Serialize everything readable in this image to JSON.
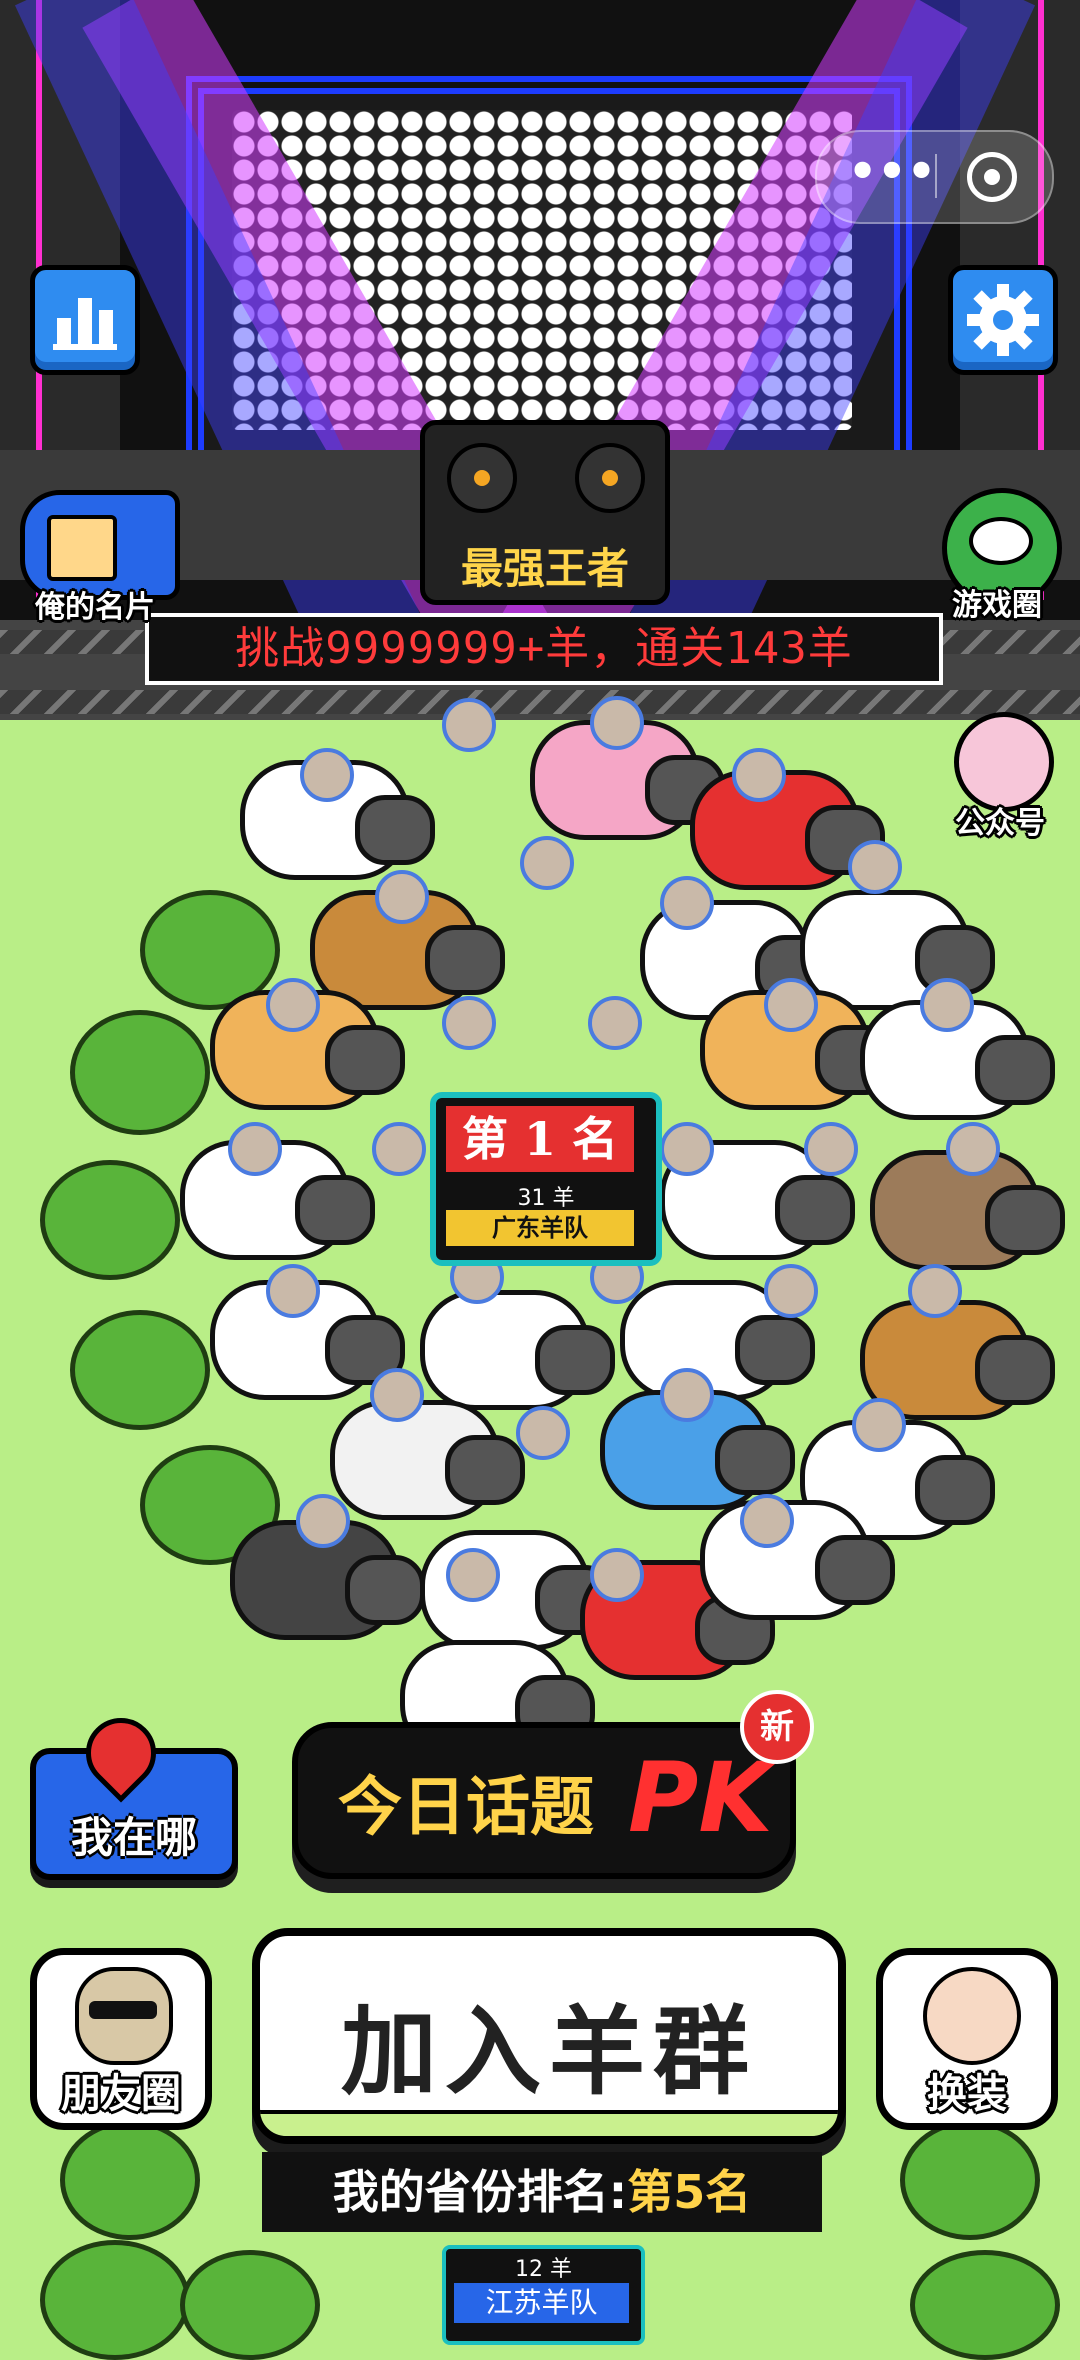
{
  "app": {
    "capsule_dots": "•••"
  },
  "stage": {
    "title": "最强王者",
    "banner": "挑战9999999+羊，通关143羊"
  },
  "left_buttons": {
    "stats_icon": "bar-chart-icon",
    "card_label": "俺的名片"
  },
  "right_buttons": {
    "settings_icon": "gear-icon",
    "game_circle_label": "游戏圈",
    "official_account_label": "公众号"
  },
  "rank_badge": {
    "title": "第 1 名",
    "count": "31 羊",
    "team": "广东羊队"
  },
  "actions": {
    "where_label": "我在哪",
    "topic_text": "今日话题",
    "topic_pk": "PK",
    "new_badge": "新",
    "join_label": "加入羊群",
    "friends_label": "朋友圈",
    "outfit_label": "换装"
  },
  "my_province": {
    "prefix": "我的省份排名:",
    "rank": "第5名"
  },
  "mini_rank": {
    "count": "12 羊",
    "team": "江苏羊队"
  },
  "colors": {
    "grass": "#b9ee87",
    "accent_blue": "#2766e8",
    "accent_red": "#e53030",
    "accent_yellow": "#ffd34a"
  }
}
